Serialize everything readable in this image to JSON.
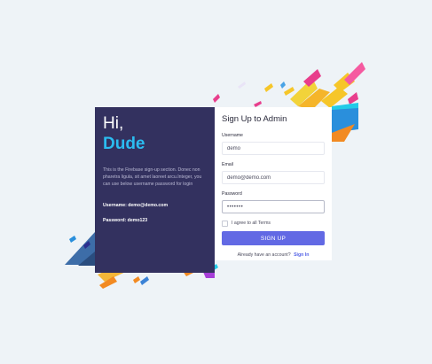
{
  "left": {
    "greeting": "Hi,",
    "name": "Dude",
    "description": "This is the Firebase sign-up section. Donec non pharetra ligula, sit amet laoreet arcu.Integer, you can use below username password for login",
    "username_line": "Username: demo@demo.com",
    "password_line": "Password: demo123"
  },
  "form": {
    "title": "Sign Up to Admin",
    "username_label": "Username",
    "username_value": "demo",
    "email_label": "Email",
    "email_value": "demo@demo.com",
    "password_label": "Password",
    "password_value": "•••••••",
    "terms_label": "I agree to all Terms",
    "submit_label": "SIGN UP",
    "account_prompt": "Already have an account?",
    "signin_label": "Sign In"
  },
  "colors": {
    "background": "#eef3f7",
    "left_panel": "#33315f",
    "accent_name": "#2bbcf0",
    "button": "#6269e4",
    "link": "#5563e6"
  }
}
